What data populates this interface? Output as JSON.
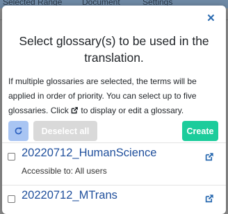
{
  "background": {
    "tabs": [
      "Selected Range",
      "Document",
      "Settings"
    ]
  },
  "modal": {
    "close_symbol": "×",
    "title": "Select glossary(s) to be used in the translation.",
    "description_before_icon": "If multiple glossaries are selected, the terms will be applied in order of priority. You can select up to five glossaries. Click ",
    "description_after_icon": " to display or edit a glossary.",
    "refresh_icon": "refresh-icon",
    "deselect_all_label": "Deselect all",
    "create_label": "Create",
    "glossaries": [
      {
        "name": "20220712_HumanScience",
        "accessible": "Accessible to: All users",
        "checked": false
      },
      {
        "name": "20220712_MTrans",
        "checked": false
      }
    ]
  },
  "colors": {
    "link": "#1f4f9c",
    "create": "#1ccc9b",
    "refresh": "#a9c5f3",
    "deselect": "#d9d9d9",
    "close": "#2a6ab0"
  }
}
